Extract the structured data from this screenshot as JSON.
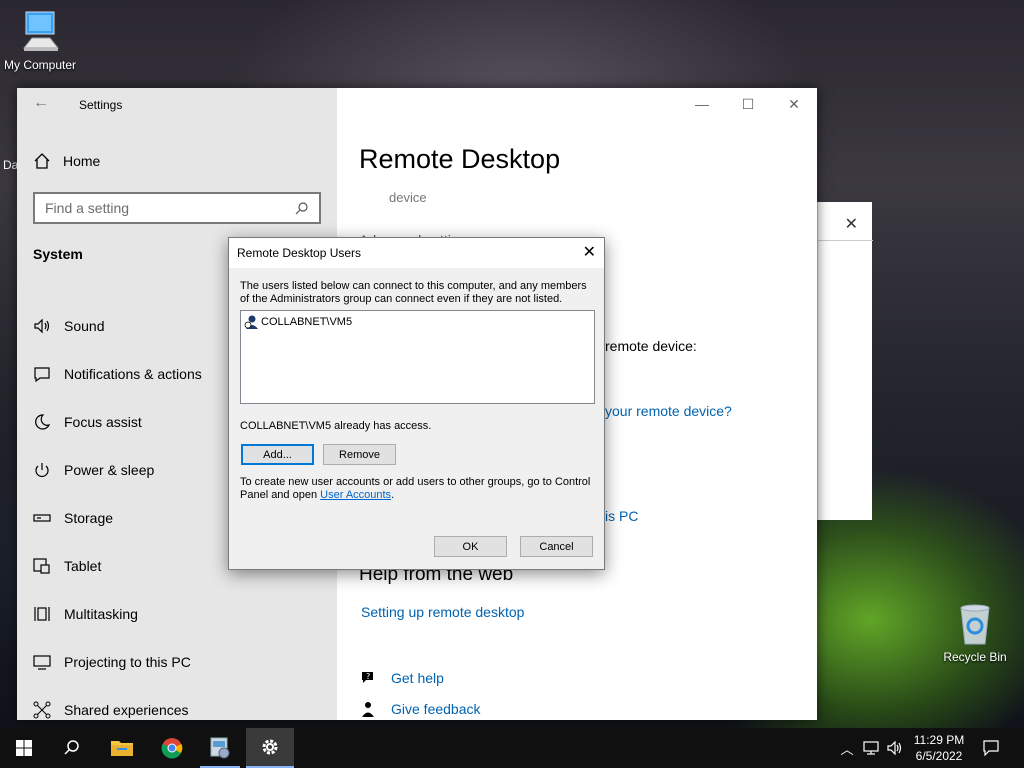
{
  "desktop": {
    "icons": [
      {
        "label": "My Computer",
        "icon": "computer-icon"
      },
      {
        "label": "Recycle Bin",
        "icon": "recycle-bin-icon"
      }
    ],
    "partial_label": "Da"
  },
  "settings": {
    "title": "Settings",
    "home": "Home",
    "search_placeholder": "Find a setting",
    "section": "System",
    "nav": [
      {
        "label": "Sound",
        "icon": "speaker-icon"
      },
      {
        "label": "Notifications & actions",
        "icon": "notification-icon"
      },
      {
        "label": "Focus assist",
        "icon": "moon-icon"
      },
      {
        "label": "Power & sleep",
        "icon": "power-icon"
      },
      {
        "label": "Storage",
        "icon": "storage-icon"
      },
      {
        "label": "Tablet",
        "icon": "tablet-icon"
      },
      {
        "label": "Multitasking",
        "icon": "multitasking-icon"
      },
      {
        "label": "Projecting to this PC",
        "icon": "projecting-icon"
      },
      {
        "label": "Shared experiences",
        "icon": "shared-icon"
      }
    ],
    "main": {
      "title": "Remote Desktop",
      "device_text": "device",
      "partial_text": "Advanced settings",
      "remote_device_text": "remote device:",
      "link_remote_device": "your remote device?",
      "link_this_pc": "is PC",
      "help_title": "Help from the web",
      "help_link": "Setting up remote desktop",
      "get_help": "Get help",
      "give_feedback": "Give feedback"
    }
  },
  "dialog": {
    "title": "Remote Desktop Users",
    "description": "The users listed below can connect to this computer, and any members of the Administrators group can connect even if they are not listed.",
    "users": [
      "COLLABNET\\VM5"
    ],
    "access_text": "COLLABNET\\VM5 already has access.",
    "add_label": "Add...",
    "remove_label": "Remove",
    "info_prefix": "To create new user accounts or add users to other groups, go to Control Panel and open ",
    "info_link": "User Accounts",
    "info_suffix": ".",
    "ok_label": "OK",
    "cancel_label": "Cancel"
  },
  "taskbar": {
    "time": "11:29 PM",
    "date": "6/5/2022"
  }
}
